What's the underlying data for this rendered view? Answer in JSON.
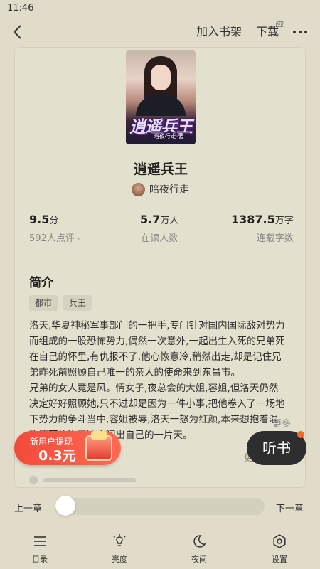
{
  "status_bar": {
    "time": "11:46"
  },
  "top_bar": {
    "add_to_shelf": "加入书架",
    "download": "下载",
    "download_badge": "vip"
  },
  "book": {
    "cover_title": "逍遥兵王",
    "cover_author": "暗夜行走·著",
    "title": "逍遥兵王",
    "author": "暗夜行走",
    "stats": [
      {
        "value": "9.5",
        "unit": "分",
        "label": "592人点评"
      },
      {
        "value": "5.7",
        "unit": "万人",
        "label": "在读人数"
      },
      {
        "value": "1387.5",
        "unit": "万字",
        "label": "连载字数"
      }
    ]
  },
  "intro": {
    "heading": "简介",
    "tags": [
      "都市",
      "兵王"
    ],
    "lines": [
      "洛天,华夏神秘军事部门的一把手,专门针对国内国际敌对势力",
      "而组成的一股恐怖势力,偶然一次意外,一起出生入死的兄弟死",
      "在自己的怀里,有仇报不了,他心恢意冷,稍然出走,却是记住兄",
      "弟昨死前照顾自己唯一的亲人的使命来到东昌市。",
      "兄弟的女人竟是风。情女子,夜总会的大姐,容姐,但洛天仍然",
      "决定好好照顾她,只不过却是因为一件小事,把他卷入了一场地",
      "下势力的争斗当中,容姐被辱,洛天一怒为红颜,本来想抱着混",
      "吃等死的洛天决定闯出自己的一片天。"
    ],
    "more": "更多",
    "faded_link": "更多书评"
  },
  "promo": {
    "line1": "新用户提现",
    "line2": "0.3元"
  },
  "listen_button": "听书",
  "chapter_nav": {
    "prev": "上一章",
    "next": "下一章",
    "progress": 0.0
  },
  "bottom_bar": [
    {
      "label": "目录",
      "icon": "list-icon"
    },
    {
      "label": "亮度",
      "icon": "brightness-icon"
    },
    {
      "label": "夜间",
      "icon": "moon-icon"
    },
    {
      "label": "设置",
      "icon": "settings-icon"
    }
  ]
}
